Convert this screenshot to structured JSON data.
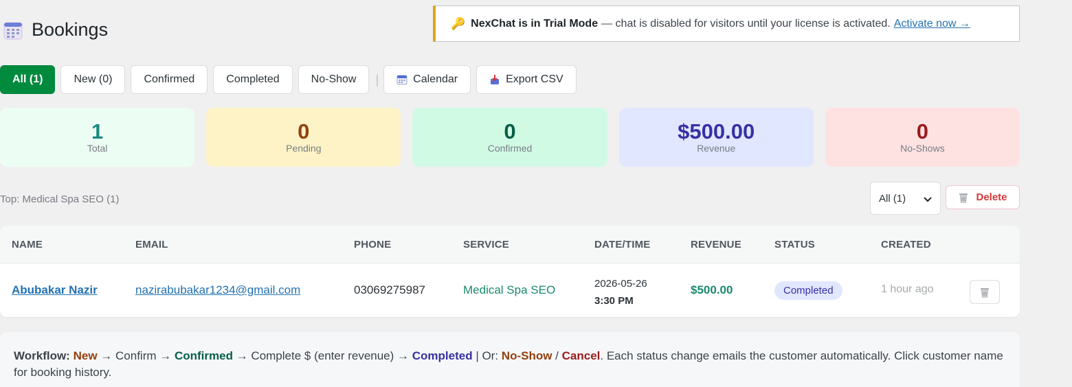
{
  "page": {
    "title": "Bookings"
  },
  "notice": {
    "brand_status": "NexChat is in Trial Mode",
    "message": "— chat is disabled for visitors until your license is activated.",
    "link": "Activate now →"
  },
  "toolbar": {
    "all": "All (1)",
    "new": "New (0)",
    "confirmed": "Confirmed",
    "completed": "Completed",
    "no_show": "No-Show",
    "separator": "|",
    "calendar": "Calendar",
    "export": "Export CSV"
  },
  "stats": {
    "total": {
      "value": "1",
      "label": "Total"
    },
    "pending": {
      "value": "0",
      "label": "Pending"
    },
    "confirmed": {
      "value": "0",
      "label": "Confirmed"
    },
    "revenue": {
      "value": "$500.00",
      "label": "Revenue"
    },
    "no_shows": {
      "value": "0",
      "label": "No-Shows"
    }
  },
  "top_service": "Top: Medical Spa SEO (1)",
  "bulk": {
    "filter_value": "All (1)",
    "delete_label": "Delete"
  },
  "table": {
    "headers": {
      "name": "NAME",
      "email": "EMAIL",
      "phone": "PHONE",
      "service": "SERVICE",
      "datetime": "DATE/TIME",
      "revenue": "REVENUE",
      "status": "STATUS",
      "created": "CREATED"
    },
    "rows": [
      {
        "name": "Abubakar Nazir",
        "email": "nazirabubakar1234@gmail.com",
        "phone": "03069275987",
        "service": "Medical Spa SEO",
        "date": "2026-05-26",
        "time": "3:30 PM",
        "revenue": "$500.00",
        "status": "Completed",
        "created": "1 hour ago"
      }
    ]
  },
  "workflow": {
    "label": "Workflow:",
    "new": "New",
    "arrow1": " → Confirm → ",
    "confirmed": "Confirmed",
    "arrow2": " → Complete $ (enter revenue) → ",
    "completed": "Completed",
    "or": " | Or: ",
    "no_show": "No-Show",
    "slash": " / ",
    "cancel": "Cancel",
    "tail": ". Each status change emails the customer automatically. Click customer name for booking history."
  },
  "colors": {
    "accent_green": "#008a3e",
    "trial_border": "#dba617",
    "link_blue": "#2271b1",
    "danger": "#d63638"
  },
  "icons": {
    "page": "calendar-icon",
    "notice": "key-icon",
    "calendar_button": "calendar-icon",
    "export_button": "export-icon",
    "filter": "chevron-down-icon",
    "delete": "trash-icon"
  }
}
